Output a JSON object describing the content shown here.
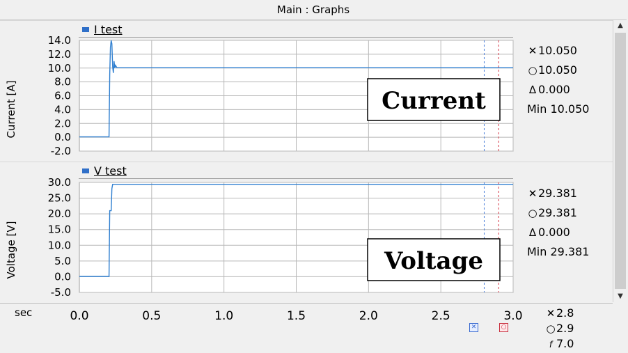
{
  "window": {
    "title": "Main : Graphs"
  },
  "x_axis": {
    "label": "sec"
  },
  "cursor_readout": {
    "cross": "2.8",
    "circle": "2.9",
    "f": "7.0"
  },
  "colors": {
    "trace": "#2f7fd0",
    "cursor_blue": "#4a7ed8",
    "cursor_red": "#d83a4a",
    "legend_swatch": "#2f6fc8"
  },
  "icons": {
    "cross": "cross-marker-icon",
    "circle": "circle-marker-icon",
    "delta": "delta-icon",
    "f": "frequency-icon"
  },
  "graphs": [
    {
      "legend": "I  test",
      "ylabel": "Current [A]",
      "overlay": "Current",
      "readout": {
        "cross": "10.050",
        "circle": "10.050",
        "delta": "0.000",
        "min": "Min 10.050"
      }
    },
    {
      "legend": "V  test",
      "ylabel": "Voltage [V]",
      "overlay": "Voltage",
      "readout": {
        "cross": "29.381",
        "circle": "29.381",
        "delta": "0.000",
        "min": "Min 29.381"
      }
    }
  ],
  "chart_data": [
    {
      "type": "line",
      "series": [
        {
          "name": "I  test",
          "x": [
            0.0,
            0.205,
            0.21,
            0.215,
            0.22,
            0.225,
            0.23,
            0.235,
            0.24,
            0.245,
            0.25,
            0.26,
            3.0
          ],
          "y": [
            0.05,
            0.05,
            9.0,
            13.0,
            14.0,
            13.5,
            10.2,
            9.3,
            11.0,
            10.0,
            10.4,
            10.05,
            10.05
          ]
        }
      ],
      "ylabel": "Current [A]",
      "xlim": [
        0.0,
        3.0
      ],
      "ylim": [
        -2.0,
        14.0
      ],
      "yticks": [
        "14.0",
        "12.0",
        "10.0",
        "8.0",
        "6.0",
        "4.0",
        "2.0",
        "0.0",
        "-2.0"
      ],
      "ytick_values": [
        14,
        12,
        10,
        8,
        6,
        4,
        2,
        0,
        -2
      ],
      "cursors": {
        "cross": 2.8,
        "circle": 2.9
      },
      "grid": true
    },
    {
      "type": "line",
      "series": [
        {
          "name": "V  test",
          "x": [
            0.0,
            0.205,
            0.21,
            0.22,
            0.225,
            0.23,
            0.235,
            3.0
          ],
          "y": [
            0.1,
            0.1,
            21.0,
            21.0,
            28.0,
            29.4,
            29.381,
            29.381
          ]
        }
      ],
      "ylabel": "Voltage [V]",
      "xlim": [
        0.0,
        3.0
      ],
      "ylim": [
        -5.0,
        30.0
      ],
      "yticks": [
        "30.0",
        "25.0",
        "20.0",
        "15.0",
        "10.0",
        "5.0",
        "0.0",
        "-5.0"
      ],
      "ytick_values": [
        30,
        25,
        20,
        15,
        10,
        5,
        0,
        -5
      ],
      "cursors": {
        "cross": 2.8,
        "circle": 2.9
      },
      "grid": true
    }
  ],
  "xticks": [
    "0.0",
    "0.5",
    "1.0",
    "1.5",
    "2.0",
    "2.5",
    "3.0"
  ],
  "xtick_values": [
    0.0,
    0.5,
    1.0,
    1.5,
    2.0,
    2.5,
    3.0
  ]
}
